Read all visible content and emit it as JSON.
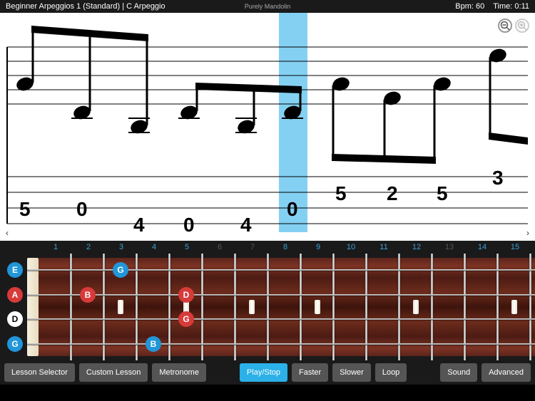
{
  "header": {
    "title": "Beginner Arpeggios 1 (Standard)  |  C Arpeggio",
    "brand": "Purely Mandolin",
    "bpm_label": "Bpm: 60",
    "time_label": "Time: 0:11"
  },
  "zoom": {
    "out": "−",
    "in": "+"
  },
  "nav": {
    "left": "‹",
    "right": "›"
  },
  "tab_numbers": [
    "5",
    "0",
    "4",
    "0",
    "4",
    "0",
    "5",
    "2",
    "5",
    "3"
  ],
  "fret_numbers": [
    {
      "n": "1",
      "dim": false
    },
    {
      "n": "2",
      "dim": false
    },
    {
      "n": "3",
      "dim": false
    },
    {
      "n": "4",
      "dim": false
    },
    {
      "n": "5",
      "dim": false
    },
    {
      "n": "6",
      "dim": true
    },
    {
      "n": "7",
      "dim": true
    },
    {
      "n": "8",
      "dim": false
    },
    {
      "n": "9",
      "dim": false
    },
    {
      "n": "10",
      "dim": false
    },
    {
      "n": "11",
      "dim": false
    },
    {
      "n": "12",
      "dim": false
    },
    {
      "n": "13",
      "dim": true
    },
    {
      "n": "14",
      "dim": false
    },
    {
      "n": "15",
      "dim": false
    }
  ],
  "strings": [
    {
      "label": "E",
      "cls": "blue"
    },
    {
      "label": "A",
      "cls": "red"
    },
    {
      "label": "D",
      "cls": "white"
    },
    {
      "label": "G",
      "cls": "blue"
    }
  ],
  "fretboard_notes": [
    {
      "string": 0,
      "fret": 3,
      "label": "G",
      "cls": "blue"
    },
    {
      "string": 1,
      "fret": 2,
      "label": "B",
      "cls": "red"
    },
    {
      "string": 1,
      "fret": 5,
      "label": "D",
      "cls": "red"
    },
    {
      "string": 2,
      "fret": 5,
      "label": "G",
      "cls": "red"
    },
    {
      "string": 3,
      "fret": 4,
      "label": "B",
      "cls": "blue"
    }
  ],
  "inlay_frets": [
    3,
    5,
    7,
    9,
    12,
    15
  ],
  "toolbar": {
    "lesson_selector": "Lesson Selector",
    "custom_lesson": "Custom Lesson",
    "metronome": "Metronome",
    "play_stop": "Play/Stop",
    "faster": "Faster",
    "slower": "Slower",
    "loop": "Loop",
    "sound": "Sound",
    "advanced": "Advanced"
  }
}
